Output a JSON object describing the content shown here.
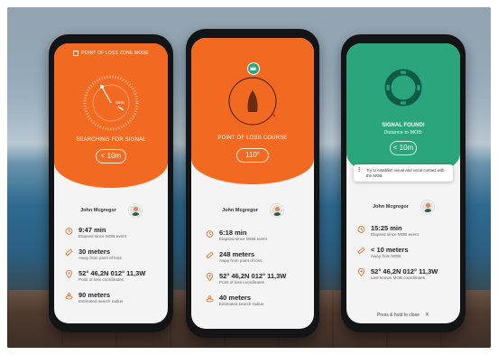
{
  "colors": {
    "orange": "#f26a21",
    "green": "#2aa57c",
    "phone": "#121416"
  },
  "phone1": {
    "header": "POINT OF LOSS ZONE MODE",
    "dial_label": "90m",
    "status": "SEARCHING FOR SIGNAL",
    "distance": "< 10m",
    "person_name": "John Mcgregor",
    "stats": [
      {
        "icon": "timer-icon",
        "value": "9:47 min",
        "label": "Elapsed since MOB event"
      },
      {
        "icon": "ruler-icon",
        "value": "30 meters",
        "label": "Away from point of loss"
      },
      {
        "icon": "location-pin-icon",
        "value": "52° 46,2N    012° 11,3W",
        "label": "Point of loss coordinates"
      },
      {
        "icon": "radius-icon",
        "value": "90 meters",
        "label": "Estimated search radius"
      }
    ]
  },
  "phone2": {
    "status": "POINT OF LOSS COURSE",
    "course": "110°",
    "person_name": "John Mcgregor",
    "stats": [
      {
        "icon": "timer-icon",
        "value": "6:18 min",
        "label": "Elapsed since MOB event"
      },
      {
        "icon": "ruler-icon",
        "value": "248 meters",
        "label": "Away from point of loss"
      },
      {
        "icon": "location-pin-icon",
        "value": "52° 46,2N    012° 11,3W",
        "label": "Point of loss coordinates"
      },
      {
        "icon": "radius-icon",
        "value": "40 meters",
        "label": "Estimated search radius"
      }
    ]
  },
  "phone3": {
    "title": "SIGNAL FOUND!",
    "subtitle": "Distance to MOB:",
    "distance": "< 10m",
    "notice": "Try to establish visual and vocal contact with the MOB.",
    "person_name": "John Mcgregor",
    "stats": [
      {
        "icon": "timer-icon",
        "value": "15:25 min",
        "label": "Elapsed since MOB event"
      },
      {
        "icon": "ruler-icon",
        "value": "< 10 meters",
        "label": "Away from MOB"
      },
      {
        "icon": "location-pin-icon",
        "value": "52° 46,2N    012° 11,3W",
        "label": "Last known MOB coordinates"
      }
    ],
    "footer": "Press & hold to close"
  }
}
